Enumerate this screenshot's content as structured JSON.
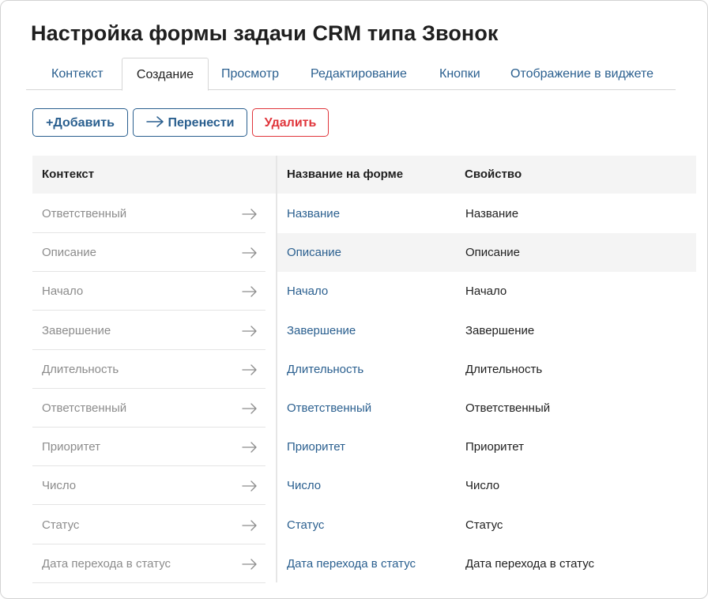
{
  "page": {
    "title": "Настройка формы задачи CRM типа Звонок"
  },
  "tabs": [
    {
      "label": "Контекст",
      "active": false
    },
    {
      "label": "Создание",
      "active": true
    },
    {
      "label": "Просмотр",
      "active": false
    },
    {
      "label": "Редактирование",
      "active": false
    },
    {
      "label": "Кнопки",
      "active": false
    },
    {
      "label": "Отображение в виджете",
      "active": false
    }
  ],
  "toolbar": {
    "add_label": "+Добавить",
    "move_label": "Перенести",
    "move_icon": "arrow-right-icon",
    "delete_label": "Удалить"
  },
  "colors": {
    "accent": "#2a5f8f",
    "danger": "#e0353b",
    "muted_text": "#8c8c8c",
    "header_bg": "#f4f4f4"
  },
  "table": {
    "headers": {
      "context": "Контекст",
      "form_name": "Название на форме",
      "property": "Свойство"
    },
    "context_rows": [
      "Ответственный",
      "Описание",
      "Начало",
      "Завершение",
      "Длительность",
      "Ответственный",
      "Приоритет",
      "Число",
      "Статус",
      "Дата перехода в статус"
    ],
    "form_rows": [
      {
        "name": "Название",
        "property": "Название",
        "highlighted": false
      },
      {
        "name": "Описание",
        "property": "Описание",
        "highlighted": true
      },
      {
        "name": "Начало",
        "property": "Начало",
        "highlighted": false
      },
      {
        "name": "Завершение",
        "property": "Завершение",
        "highlighted": false
      },
      {
        "name": "Длительность",
        "property": "Длительность",
        "highlighted": false
      },
      {
        "name": "Ответственный",
        "property": "Ответственный",
        "highlighted": false
      },
      {
        "name": "Приоритет",
        "property": "Приоритет",
        "highlighted": false
      },
      {
        "name": "Число",
        "property": "Число",
        "highlighted": false
      },
      {
        "name": "Статус",
        "property": "Статус",
        "highlighted": false
      },
      {
        "name": "Дата перехода в статус",
        "property": "Дата перехода в статус",
        "highlighted": false
      }
    ]
  }
}
